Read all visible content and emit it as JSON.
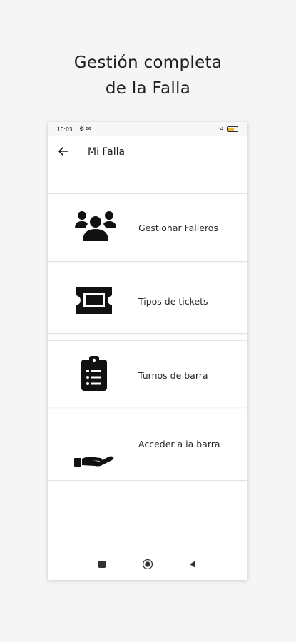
{
  "headline": {
    "line1": "Gestión completa",
    "line2": "de la Falla"
  },
  "statusbar": {
    "time": "10:03",
    "left_icons": "⚙ ✉",
    "right_icons": "⊿ᐧ"
  },
  "appbar": {
    "title": "Mi Falla"
  },
  "menu": [
    {
      "label": "Gestionar Falleros",
      "icon": "people-group-icon"
    },
    {
      "label": "Tipos de tickets",
      "icon": "ticket-icon"
    },
    {
      "label": "Turnos de barra",
      "icon": "clipboard-list-icon"
    },
    {
      "label": "Acceder a la barra",
      "icon": "hand-holding-icon"
    }
  ],
  "navbar": {
    "icons": [
      "recent-apps-icon",
      "home-icon",
      "back-triangle-icon"
    ]
  }
}
